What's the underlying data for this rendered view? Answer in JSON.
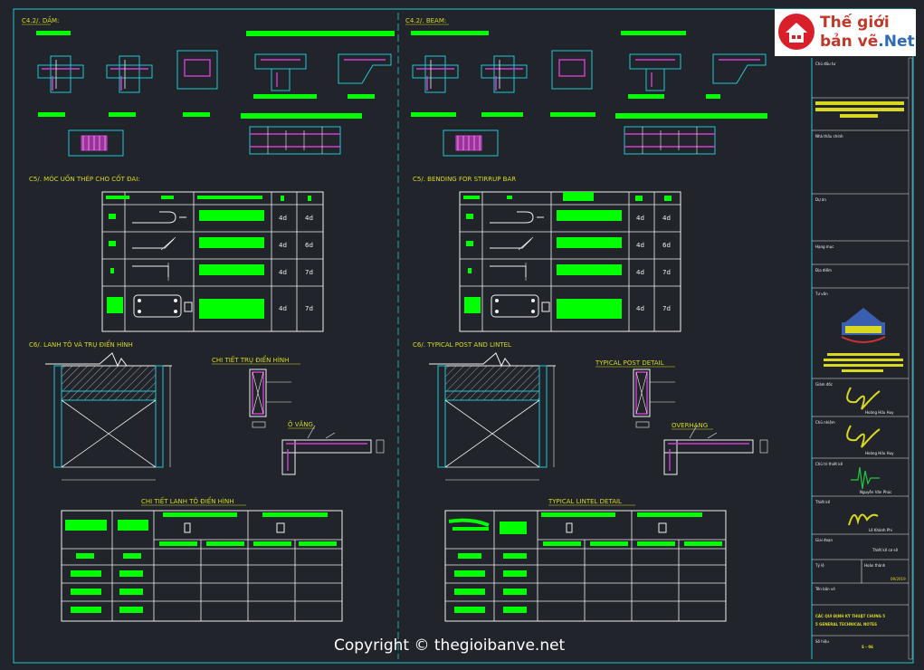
{
  "sections": {
    "beam_vi": "C4.2/. DẦM:",
    "beam_en": "C4.2/. BEAM:",
    "hook_vi": "C5/. MÓC UỐN THÉP CHO CỐT ĐAI:",
    "hook_en": "C5/. BENDING FOR STIRRUP BAR",
    "lintel_vi": "C6/. LANH TÔ VÀ TRỤ ĐIỂN HÌNH",
    "lintel_en": "C6/. TYPICAL POST AND LINTEL",
    "post_vi": "CHI TIẾT TRỤ ĐIỂN HÌNH",
    "post_en": "TYPICAL POST DETAIL",
    "overhang_vi": "Ô VĂNG",
    "overhang_en": "OVERHANG",
    "lintel_detail_vi": "CHI TIẾT LANH TÔ ĐIỂN HÌNH",
    "lintel_detail_en": "TYPICAL LINTEL DETAIL"
  },
  "hook_table": {
    "rows": [
      {
        "a": "4d",
        "b": "4d"
      },
      {
        "a": "4d",
        "b": "6d"
      },
      {
        "a": "4d",
        "b": "7d"
      },
      {
        "a": "4d",
        "b": "7d"
      }
    ]
  },
  "title_block": {
    "owner_label": "Chủ đầu tư",
    "contractor_label": "Nhà thầu chính",
    "project_label": "Dự án",
    "item_label": "Hạng mục",
    "location_label": "Địa điểm",
    "consultant_label": "Tư vấn",
    "director_label": "Giám đốc",
    "director_name": "Hoàng Hữu Huy",
    "manager_label": "Chủ nhiệm",
    "manager_name": "Hoàng Hữu Huy",
    "chief_designer_label": "Chủ trì thiết kế",
    "chief_designer_name": "Nguyễn Văn Phúc",
    "designer_label": "Thiết kế",
    "designer_name": "Lê Khánh Phi",
    "stage_label": "Giai đoạn",
    "stage_value": "Thiết kế cơ sở",
    "scale_label": "Tỷ lệ",
    "date_label": "Hoàn thành",
    "date_value": "09/2019",
    "drawing_name_label": "Tên bản vẽ",
    "drawing_name": "CÁC QUI ĐỊNH KỸ THUẬT CHUNG 5",
    "drawing_name_en": "5 GENERAL TECHNICAL NOTES",
    "sheet_label": "Số hiệu",
    "sheet_no": "S - 06"
  },
  "logo": {
    "line1": "Thế giới",
    "line2": "bản vẽ",
    "line2_suffix": ".Net"
  },
  "copyright": "Copyright © thegioibanve.net"
}
